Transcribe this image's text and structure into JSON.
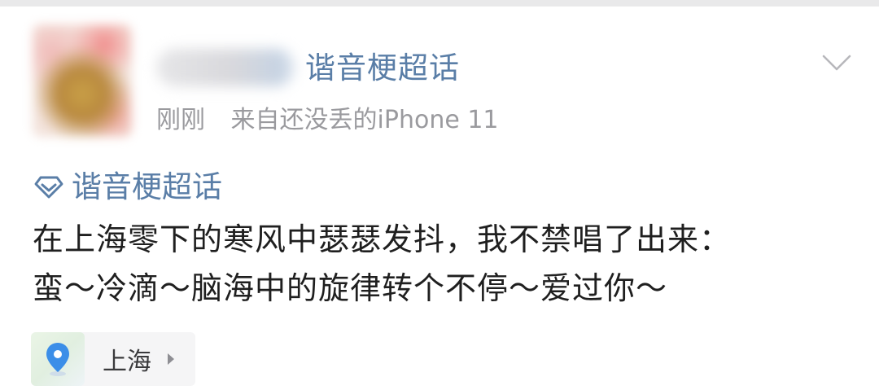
{
  "post": {
    "topic_title": "谐音梗超话",
    "time": "刚刚",
    "source": "来自还没丢的iPhone 11",
    "topic_tag": "谐音梗超话",
    "content_lines": [
      "在上海零下的寒风中瑟瑟发抖，我不禁唱了出来：",
      "蛮～冷滴～脑海中的旋律转个不停～爱过你～"
    ],
    "location": "上海",
    "icons": {
      "topic": "super-topic-icon",
      "location": "location-pin-icon",
      "menu": "chevron-down-icon"
    },
    "colors": {
      "link": "#5a7ea7",
      "meta": "#9a9a9e",
      "pin": "#3b8ee8"
    }
  }
}
